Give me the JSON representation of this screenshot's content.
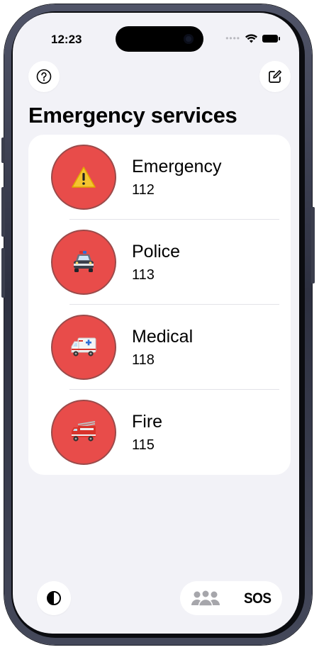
{
  "status_bar": {
    "time": "12:23",
    "signal_dots": "••••"
  },
  "header": {
    "title": "Emergency services",
    "help_icon": "question-circle-icon",
    "edit_icon": "compose-icon"
  },
  "services": [
    {
      "name": "Emergency",
      "number": "112",
      "icon": "warning-icon"
    },
    {
      "name": "Police",
      "number": "113",
      "icon": "police-car-icon"
    },
    {
      "name": "Medical",
      "number": "118",
      "icon": "ambulance-icon"
    },
    {
      "name": "Fire",
      "number": "115",
      "icon": "fire-engine-icon"
    }
  ],
  "bottom_bar": {
    "theme_icon": "contrast-icon",
    "contacts_icon": "group-icon",
    "sos_label": "SOS"
  },
  "colors": {
    "service_circle": "#e84c4a",
    "background": "#f2f2f7"
  }
}
